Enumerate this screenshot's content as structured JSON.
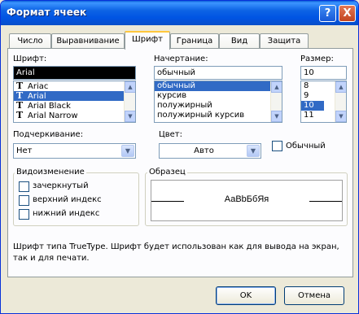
{
  "title": "Формат ячеек",
  "titlebar_buttons": {
    "help": "?",
    "close": "X"
  },
  "tabs": [
    "Число",
    "Выравнивание",
    "Шрифт",
    "Граница",
    "Вид",
    "Защита"
  ],
  "active_tab": "Шрифт",
  "font": {
    "label": "Шрифт:",
    "value": "Arial",
    "items": [
      {
        "icon": "truetype-icon",
        "label": "Ariac",
        "selected": false
      },
      {
        "icon": "truetype-icon",
        "label": "Arial",
        "selected": true
      },
      {
        "icon": "truetype-icon",
        "label": "Arial Black",
        "selected": false
      },
      {
        "icon": "truetype-icon",
        "label": "Arial Narrow",
        "selected": false
      }
    ]
  },
  "style": {
    "label": "Начертание:",
    "value": "обычный",
    "items": [
      {
        "label": "обычный",
        "selected": true
      },
      {
        "label": "курсив",
        "selected": false
      },
      {
        "label": "полужирный",
        "selected": false
      },
      {
        "label": "полужирный курсив",
        "selected": false
      }
    ]
  },
  "size": {
    "label": "Размер:",
    "value": "10",
    "items": [
      {
        "label": "8",
        "selected": false
      },
      {
        "label": "9",
        "selected": false
      },
      {
        "label": "10",
        "selected": true
      },
      {
        "label": "11",
        "selected": false
      }
    ]
  },
  "underline": {
    "label": "Подчеркивание:",
    "value": "Нет"
  },
  "color": {
    "label": "Цвет:",
    "value": "Авто"
  },
  "normal_checkbox": {
    "label": "Обычный",
    "checked": false
  },
  "effects": {
    "title": "Видоизменение",
    "items": [
      {
        "label": "зачеркнутый",
        "checked": false
      },
      {
        "label": "верхний индекс",
        "checked": false
      },
      {
        "label": "нижний индекс",
        "checked": false
      }
    ]
  },
  "preview": {
    "title": "Образец",
    "text": "АаВbБбЯя"
  },
  "description": "Шрифт типа TrueType. Шрифт будет использован как для вывода на экран, так и для печати.",
  "buttons": {
    "ok": "OK",
    "cancel": "Отмена"
  },
  "colors": {
    "title_bar": "#0054e3",
    "selection": "#316ac5",
    "dialog_bg": "#ece9d8",
    "panel_bg": "#fcfcfe"
  }
}
